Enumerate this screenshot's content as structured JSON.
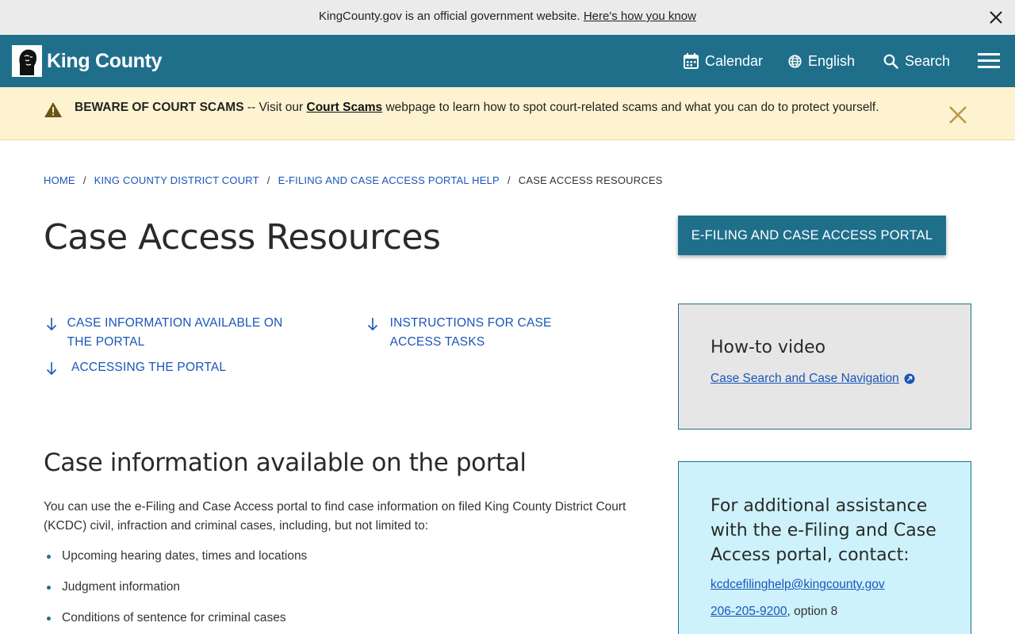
{
  "gov_banner": {
    "text": "KingCounty.gov is an official government website.",
    "link": "Here's how you know"
  },
  "header": {
    "logo_text": "King County",
    "nav": {
      "calendar": "Calendar",
      "language": "English",
      "search": "Search"
    }
  },
  "alert": {
    "title": "BEWARE OF COURT SCAMS",
    "pre_link": " -- Visit our ",
    "link": "Court Scams",
    "post_link": " webpage to learn how to spot court-related scams and what you can do to protect yourself."
  },
  "breadcrumb": {
    "items": [
      "HOME",
      "KING COUNTY DISTRICT COURT",
      "E-FILING AND CASE ACCESS PORTAL HELP"
    ],
    "current": "CASE ACCESS RESOURCES",
    "separator": "/"
  },
  "page": {
    "title": "Case Access Resources",
    "portal_button": "E-FILING AND CASE ACCESS PORTAL"
  },
  "jump_links": [
    "CASE INFORMATION AVAILABLE ON THE PORTAL",
    "INSTRUCTIONS FOR CASE ACCESS TASKS",
    "ACCESSING THE PORTAL"
  ],
  "section": {
    "title": "Case information available on the portal",
    "body": "You can use the e-Filing and Case Access portal to find case information on filed King County District Court (KCDC) civil, infraction and criminal cases, including, but not limited to:",
    "bullets": [
      "Upcoming hearing dates, times and locations",
      "Judgment information",
      "Conditions of sentence for criminal cases"
    ]
  },
  "video_box": {
    "title": "How-to video",
    "link": "Case Search and Case Navigation"
  },
  "assist_box": {
    "title": "For additional assistance with the e-Filing and Case Access portal, contact:",
    "email": "kcdcefilinghelp@kingcounty.gov",
    "phone": "206-205-9200",
    "phone_suffix": ", option 8"
  },
  "colors": {
    "brand": "#1f6f8b",
    "link": "#1a56b8",
    "alert_bg": "#fdf3d1",
    "video_bg": "#e6e6e6",
    "assist_bg": "#cdf2fb"
  }
}
